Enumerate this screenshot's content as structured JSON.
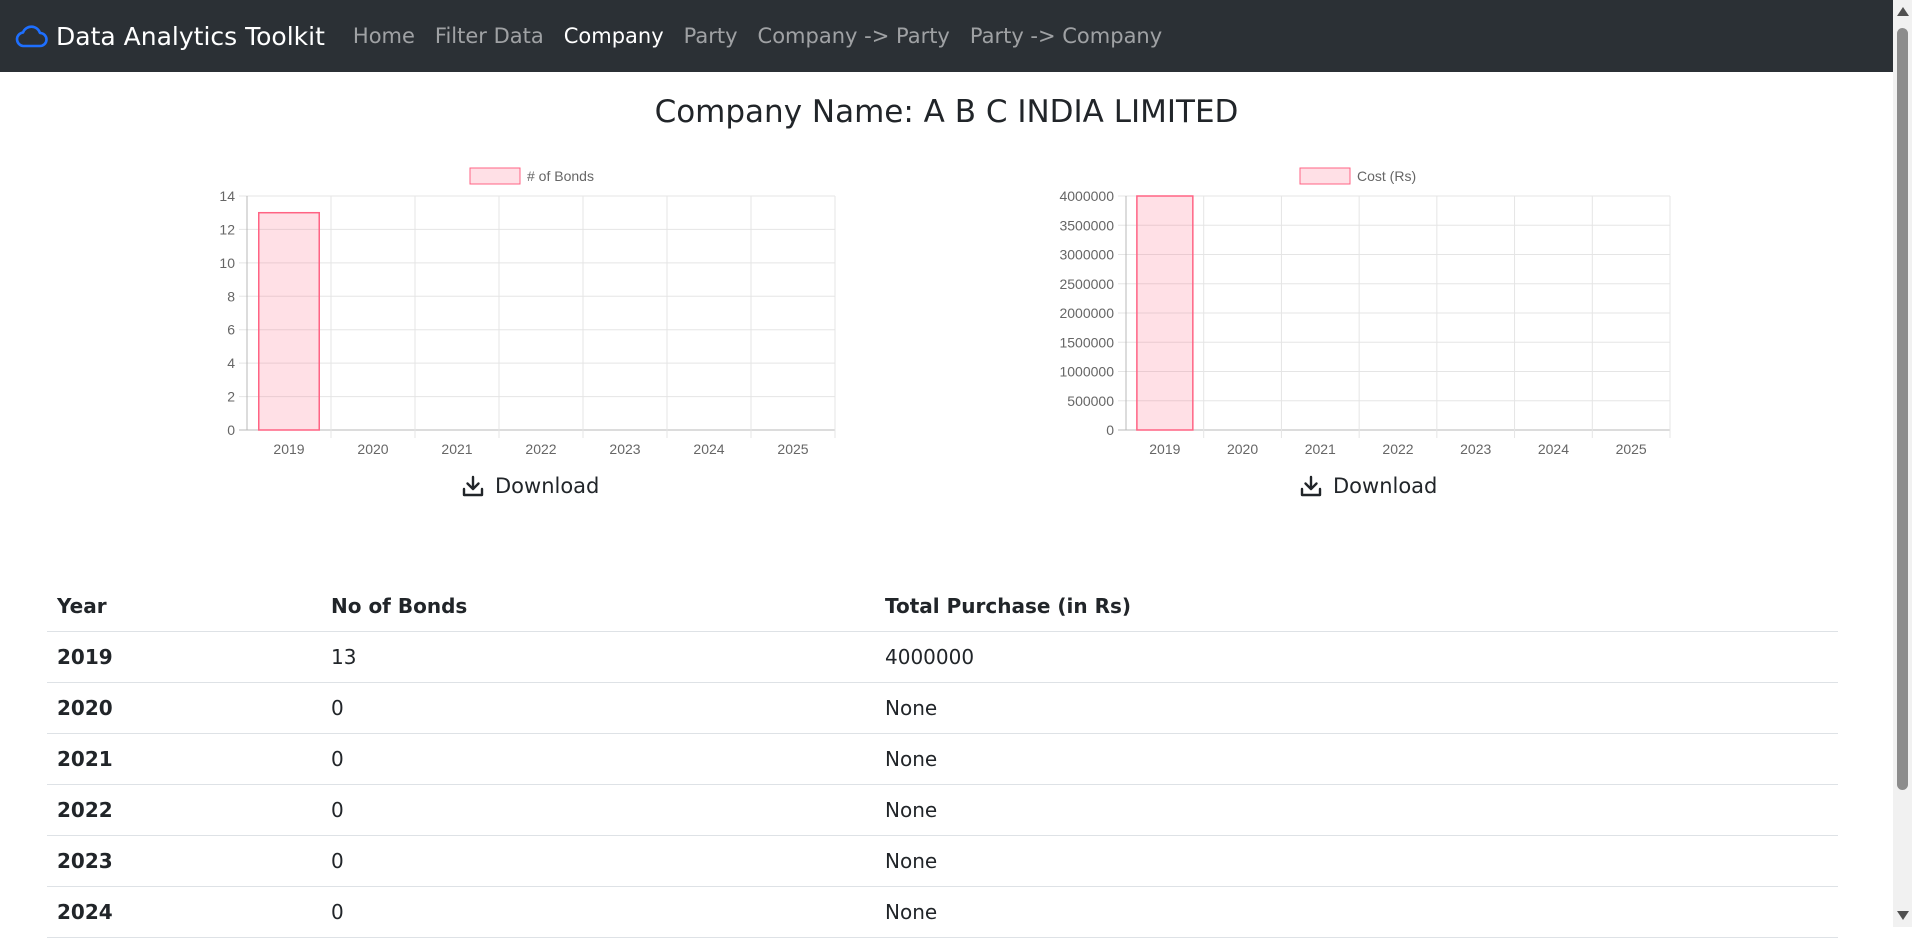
{
  "navbar": {
    "brand": "Data Analytics Toolkit",
    "brand_icon": "cloud-icon",
    "links": [
      "Home",
      "Filter Data",
      "Company",
      "Party",
      "Company -> Party",
      "Party -> Company"
    ],
    "active": "Company"
  },
  "page": {
    "title": "Company Name: A B C INDIA LIMITED",
    "download_label": "Download",
    "download_icon": "download-icon"
  },
  "chart_data": [
    {
      "type": "bar",
      "categories": [
        "2019",
        "2020",
        "2021",
        "2022",
        "2023",
        "2024",
        "2025"
      ],
      "series": [
        {
          "name": "# of Bonds",
          "values": [
            13,
            0,
            0,
            0,
            0,
            0,
            0
          ]
        }
      ],
      "ylim": [
        0,
        14
      ],
      "yticks": [
        0,
        2,
        4,
        6,
        8,
        10,
        12,
        14
      ],
      "legend": "top",
      "grid": true,
      "color": "#ff6384"
    },
    {
      "type": "bar",
      "categories": [
        "2019",
        "2020",
        "2021",
        "2022",
        "2023",
        "2024",
        "2025"
      ],
      "series": [
        {
          "name": "Cost (Rs)",
          "values": [
            4000000,
            0,
            0,
            0,
            0,
            0,
            0
          ]
        }
      ],
      "ylim": [
        0,
        4000000
      ],
      "yticks": [
        0,
        500000,
        1000000,
        1500000,
        2000000,
        2500000,
        3000000,
        3500000,
        4000000
      ],
      "legend": "top",
      "grid": true,
      "color": "#ff6384"
    }
  ],
  "table": {
    "headers": [
      "Year",
      "No of Bonds",
      "Total Purchase (in Rs)"
    ],
    "rows": [
      [
        "2019",
        "13",
        "4000000"
      ],
      [
        "2020",
        "0",
        "None"
      ],
      [
        "2021",
        "0",
        "None"
      ],
      [
        "2022",
        "0",
        "None"
      ],
      [
        "2023",
        "0",
        "None"
      ],
      [
        "2024",
        "0",
        "None"
      ]
    ]
  }
}
